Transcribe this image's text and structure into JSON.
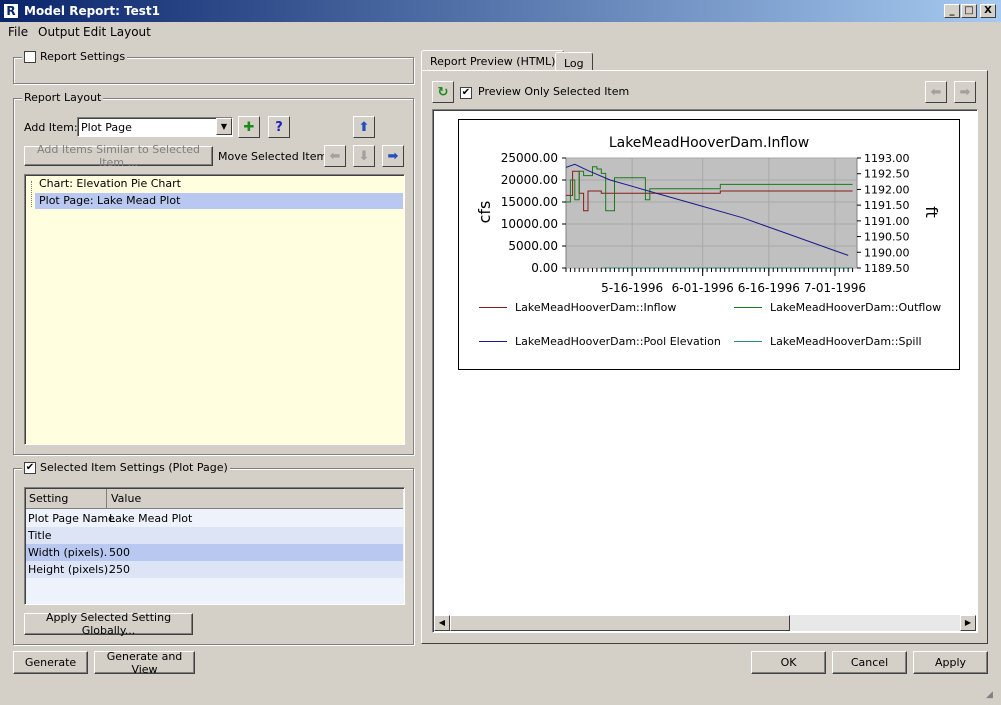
{
  "window": {
    "title": "Model Report: Test1",
    "controls": [
      "_",
      "□",
      "X"
    ]
  },
  "menu": [
    "File",
    "Output",
    "Edit Layout"
  ],
  "report_settings": {
    "label": "Report Settings",
    "checked": false
  },
  "report_layout": {
    "label": "Report Layout",
    "add_item_label": "Add Item:",
    "add_item_value": "Plot Page",
    "add_similar_button": "Add Items Similar to Selected Item ...",
    "move_selected_label": "Move Selected Item:",
    "items": [
      "Chart: Elevation Pie Chart",
      "Plot Page: Lake Mead Plot"
    ],
    "selected_index": 1
  },
  "selected_item_settings": {
    "label": "Selected Item Settings (Plot Page)",
    "checked": true,
    "columns": [
      "Setting",
      "Value"
    ],
    "rows": [
      {
        "setting": "Plot Page Name",
        "value": "Lake Mead Plot"
      },
      {
        "setting": "Title",
        "value": ""
      },
      {
        "setting": "Width (pixels).",
        "value": "500"
      },
      {
        "setting": "Height (pixels).",
        "value": "250"
      }
    ],
    "apply_globally_button": "Apply Selected Setting Globally..."
  },
  "tabs": [
    "Report Preview (HTML)",
    "Log"
  ],
  "preview": {
    "only_selected_label": "Preview Only Selected Item",
    "only_selected_checked": true
  },
  "bottom_buttons": {
    "generate": "Generate",
    "generate_view": "Generate and View",
    "ok": "OK",
    "cancel": "Cancel",
    "apply": "Apply"
  },
  "chart_data": {
    "type": "line",
    "title": "LakeMeadHooverDam.Inflow",
    "ylabel": "cfs",
    "y2label": "ft",
    "x_ticks": [
      "5-16-1996",
      "6-01-1996",
      "6-16-1996",
      "7-01-1996"
    ],
    "y_ticks": [
      "25000.00",
      "20000.00",
      "15000.00",
      "10000.00",
      "5000.00",
      "0.00"
    ],
    "y2_ticks": [
      "1193.00",
      "1192.50",
      "1192.00",
      "1191.50",
      "1191.00",
      "1190.50",
      "1190.00",
      "1189.50"
    ],
    "ylim": [
      0,
      25000
    ],
    "y2lim": [
      1189.5,
      1193.0
    ],
    "x_range_days": [
      "5-01-1996",
      "7-06-1996"
    ],
    "series": [
      {
        "name": "LakeMeadHooverDam::Inflow",
        "color": "#8b1a1a",
        "axis": "left",
        "points": [
          [
            0,
            16500
          ],
          [
            1.5,
            16500
          ],
          [
            1.5,
            22000
          ],
          [
            3,
            22000
          ],
          [
            3,
            17000
          ],
          [
            4,
            17000
          ],
          [
            4,
            13000
          ],
          [
            5,
            13000
          ],
          [
            5,
            17500
          ],
          [
            8,
            17500
          ],
          [
            8,
            17000
          ],
          [
            20,
            17000
          ],
          [
            20,
            17000
          ],
          [
            35,
            17000
          ],
          [
            35,
            17500
          ],
          [
            65,
            17500
          ]
        ]
      },
      {
        "name": "LakeMeadHooverDam::Outflow",
        "color": "#1a7a1a",
        "axis": "left",
        "points": [
          [
            0,
            15000
          ],
          [
            1,
            15000
          ],
          [
            1,
            20000
          ],
          [
            2,
            20000
          ],
          [
            2,
            15500
          ],
          [
            3,
            15500
          ],
          [
            3,
            22000
          ],
          [
            4,
            22000
          ],
          [
            4,
            21000
          ],
          [
            6,
            21000
          ],
          [
            6,
            23000
          ],
          [
            7,
            23000
          ],
          [
            7,
            22500
          ],
          [
            8,
            22500
          ],
          [
            8,
            21500
          ],
          [
            9,
            21500
          ],
          [
            9,
            13000
          ],
          [
            11,
            13000
          ],
          [
            11,
            20500
          ],
          [
            18,
            20500
          ],
          [
            18,
            15500
          ],
          [
            19,
            15500
          ],
          [
            19,
            18000
          ],
          [
            35,
            18000
          ],
          [
            35,
            19000
          ],
          [
            65,
            19000
          ]
        ]
      },
      {
        "name": "LakeMeadHooverDam::Pool Elevation",
        "color": "#1a1a8b",
        "axis": "right",
        "points": [
          [
            0,
            1192.7
          ],
          [
            2,
            1192.8
          ],
          [
            5,
            1192.6
          ],
          [
            10,
            1192.3
          ],
          [
            20,
            1191.9
          ],
          [
            30,
            1191.5
          ],
          [
            40,
            1191.1
          ],
          [
            50,
            1190.6
          ],
          [
            60,
            1190.1
          ],
          [
            64,
            1189.9
          ]
        ]
      },
      {
        "name": "LakeMeadHooverDam::Spill",
        "color": "#2a8a8a",
        "axis": "left",
        "points": [
          [
            8,
            0
          ],
          [
            65,
            0
          ]
        ]
      }
    ]
  }
}
